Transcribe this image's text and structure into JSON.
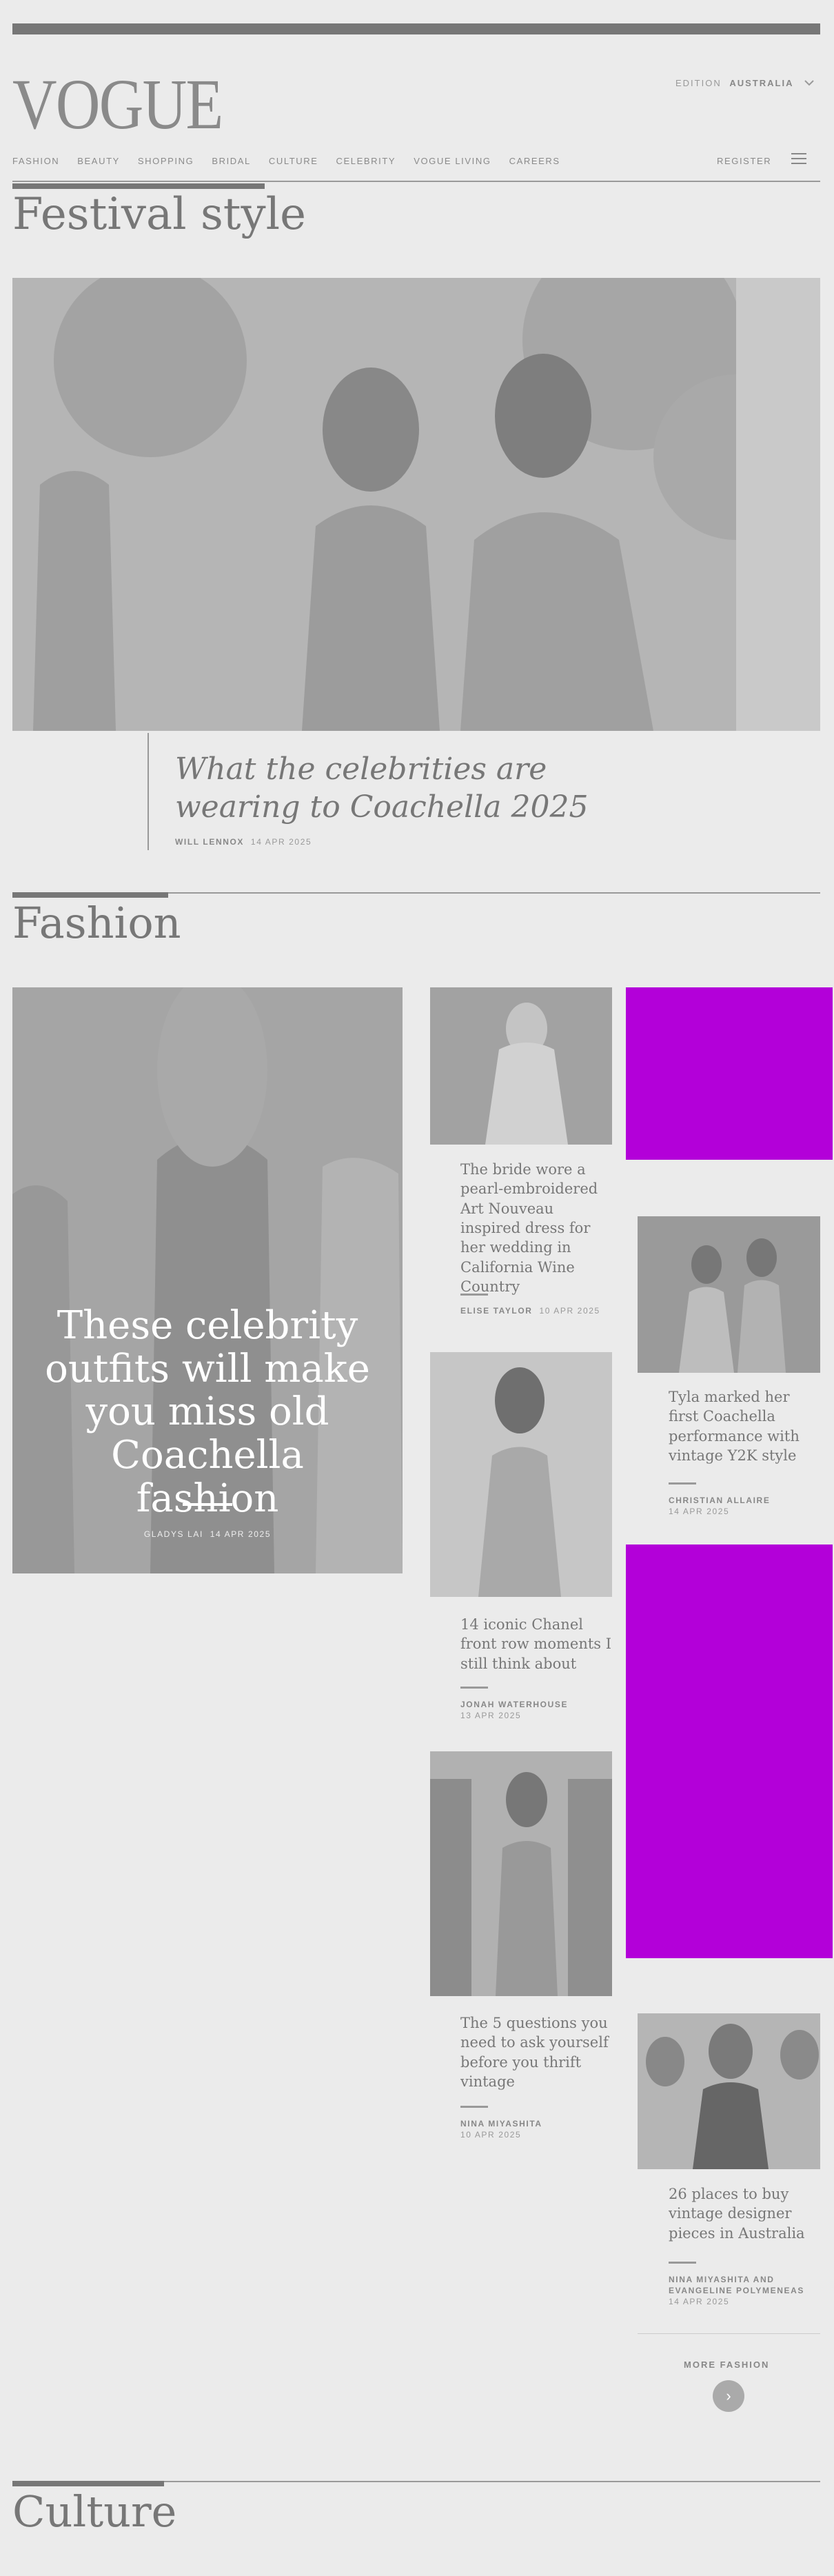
{
  "header": {
    "logo": "VOGUE",
    "edition_label": "EDITION",
    "edition_value": "AUSTRALIA",
    "register_label": "REGISTER",
    "nav": [
      "FASHION",
      "BEAUTY",
      "SHOPPING",
      "BRIDAL",
      "CULTURE",
      "CELEBRITY",
      "VOGUE LIVING",
      "CAREERS"
    ]
  },
  "festival": {
    "section_title": "Festival style",
    "headline": "What the celebrities are wearing to Coachella 2025",
    "author": "WILL LENNOX",
    "date": "14 APR 2025"
  },
  "fashion": {
    "section_title": "Fashion",
    "feature": {
      "headline": "These celebrity outfits will make you miss old Coachella fashion",
      "author": "GLADYS LAI",
      "date": "14 APR 2025"
    },
    "cards": [
      {
        "headline": "The bride wore a pearl-embroidered Art Nouveau inspired dress for her wedding in California Wine Country",
        "author": "ELISE TAYLOR",
        "date": "10 APR 2025"
      },
      {
        "headline": "Tyla marked her first Coachella performance with vintage Y2K style",
        "author": "CHRISTIAN ALLAIRE",
        "date": "14 APR 2025"
      },
      {
        "headline": "14 iconic Chanel front row moments I still think about",
        "author": "JONAH WATERHOUSE",
        "date": "13 APR 2025"
      },
      {
        "headline": "The 5 questions you need to ask yourself before you thrift vintage",
        "author": "NINA MIYASHITA",
        "date": "10 APR 2025"
      },
      {
        "headline": "26 places to buy vintage designer pieces in Australia",
        "author": "NINA MIYASHITA AND EVANGELINE POLYMENEAS",
        "date": "14 APR 2025"
      }
    ],
    "more_label": "MORE FASHION"
  },
  "culture": {
    "section_title": "Culture"
  },
  "colors": {
    "ad": "#b300d9",
    "accent": "#777777"
  }
}
